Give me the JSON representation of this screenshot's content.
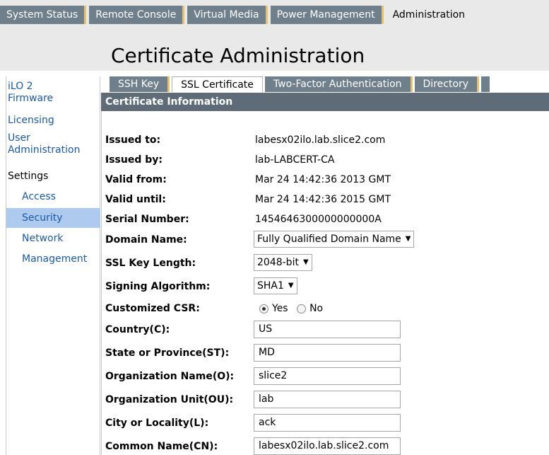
{
  "top_tabs": [
    {
      "label": "System Status"
    },
    {
      "label": "Remote Console"
    },
    {
      "label": "Virtual Media"
    },
    {
      "label": "Power Management"
    },
    {
      "label": "Administration"
    }
  ],
  "page_title": "Certificate Administration",
  "sidebar": {
    "items": [
      {
        "label": "iLO 2\nFirmware"
      },
      {
        "label": "Licensing"
      },
      {
        "label": "User Administration"
      },
      {
        "label": "Settings"
      },
      {
        "label": "Access"
      },
      {
        "label": "Security"
      },
      {
        "label": "Network"
      },
      {
        "label": "Management"
      }
    ],
    "ilo_line1": "iLO 2",
    "ilo_line2": "Firmware",
    "user_line1": "User",
    "user_line2": "Administration"
  },
  "sub_tabs": [
    {
      "label": "SSH Key"
    },
    {
      "label": "SSL Certificate"
    },
    {
      "label": "Two-Factor Authentication"
    },
    {
      "label": "Directory"
    }
  ],
  "section_header": "Certificate Information",
  "cert": {
    "issued_to_label": "Issued to:",
    "issued_to": "labesx02ilo.lab.slice2.com",
    "issued_by_label": "Issued by:",
    "issued_by": "lab-LABCERT-CA",
    "valid_from_label": "Valid from:",
    "valid_from": "Mar 24 14:42:36 2013 GMT",
    "valid_until_label": "Valid until:",
    "valid_until": "Mar 24 14:42:36 2015 GMT",
    "serial_label": "Serial Number:",
    "serial": "1454646300000000000A"
  },
  "csr": {
    "domain_label": "Domain Name:",
    "domain_value": "Fully Qualified Domain Name",
    "keylen_label": "SSL Key Length:",
    "keylen_value": "2048-bit",
    "alg_label": "Signing Algorithm:",
    "alg_value": "SHA1",
    "custom_label": "Customized CSR:",
    "yes_label": "Yes",
    "no_label": "No",
    "country_label": "Country(C):",
    "country": "US",
    "state_label": "State or Province(ST):",
    "state": "MD",
    "org_label": "Organization Name(O):",
    "org": "slice2",
    "ou_label": "Organization Unit(OU):",
    "ou": "lab",
    "city_label": "City or Locality(L):",
    "city": "ack",
    "cn_label": "Common Name(CN):",
    "cn": "labesx02ilo.lab.slice2.com"
  }
}
